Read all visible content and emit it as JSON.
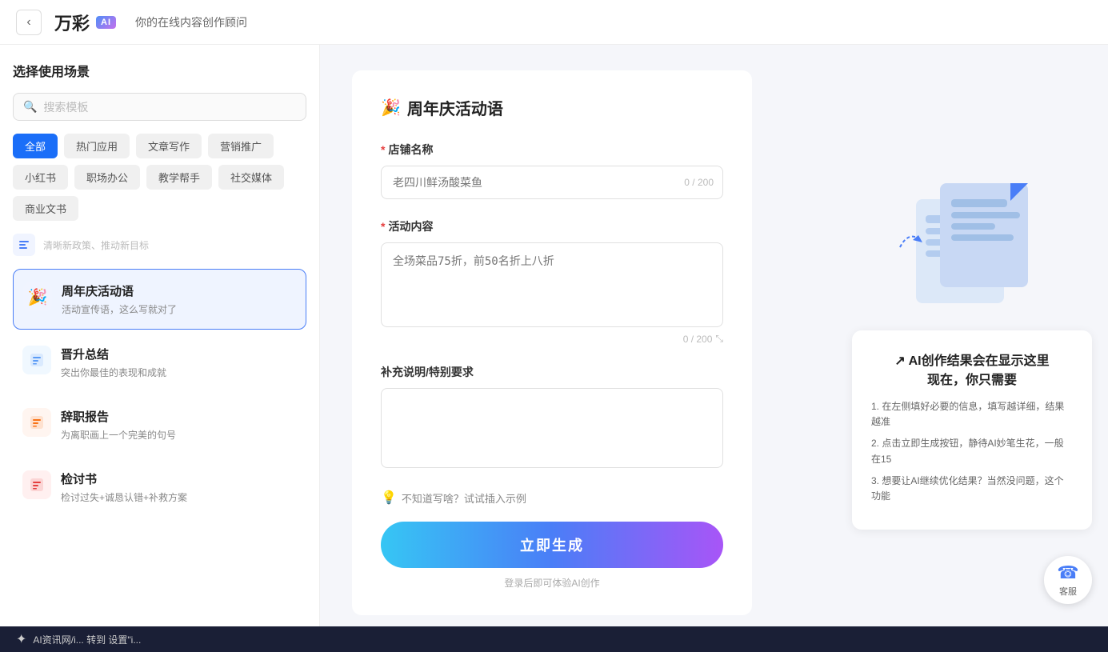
{
  "header": {
    "back_label": "‹",
    "logo_text": "万彩",
    "logo_ai": "AI",
    "subtitle": "你的在线内容创作顾问"
  },
  "sidebar": {
    "title": "选择使用场景",
    "search_placeholder": "搜索模板",
    "tags": [
      {
        "label": "全部",
        "active": true
      },
      {
        "label": "热门应用",
        "active": false
      },
      {
        "label": "文章写作",
        "active": false
      },
      {
        "label": "营销推广",
        "active": false
      },
      {
        "label": "小红书",
        "active": false
      },
      {
        "label": "职场办公",
        "active": false
      },
      {
        "label": "教学帮手",
        "active": false
      },
      {
        "label": "社交媒体",
        "active": false
      },
      {
        "label": "商业文书",
        "active": false
      }
    ],
    "divider_text": "清晰新政策、推动新目标",
    "items": [
      {
        "id": "anniversary",
        "icon": "🎉",
        "icon_bg": "#f0f4ff",
        "title": "周年庆活动语",
        "desc": "活动宣传语，这么写就对了",
        "active": true
      },
      {
        "id": "promotion",
        "icon": "📋",
        "icon_bg": "#f0f8ff",
        "title": "晋升总结",
        "desc": "突出你最佳的表现和成就",
        "active": false
      },
      {
        "id": "resignation",
        "icon": "📝",
        "icon_bg": "#fff5f0",
        "title": "辞职报告",
        "desc": "为离职画上一个完美的句号",
        "active": false
      },
      {
        "id": "review",
        "icon": "📌",
        "icon_bg": "#fff0f0",
        "title": "检讨书",
        "desc": "检讨过失+诚恳认错+补救方案",
        "active": false
      }
    ]
  },
  "form": {
    "title": "周年庆活动语",
    "title_icon": "🎉",
    "fields": {
      "shop_name": {
        "label": "店铺名称",
        "required": true,
        "placeholder": "老四川鲜汤酸菜鱼",
        "char_count": "0 / 200"
      },
      "activity_content": {
        "label": "活动内容",
        "required": true,
        "placeholder": "全场菜品75折，前50名折上八折",
        "char_count": "0 / 200"
      },
      "supplement": {
        "label": "补充说明/特别要求",
        "required": false,
        "placeholder": ""
      }
    },
    "hint_icon": "💡",
    "hint_text": "不知道写啥？试试插入示例",
    "generate_btn": "立即生成",
    "login_hint": "登录后即可体验AI创作"
  },
  "right_panel": {
    "info_title_prefix": "AI创作结果会在显示这里",
    "info_subtitle": "现在，你只需要",
    "info_items": [
      "1. 在左侧填好必要的信息，填写越详细，结果越准",
      "2. 点击立即生成按钮，静待AI妙笔生花，一般在15",
      "3. 想要让AI继续优化结果？当然没问题，这个功能"
    ]
  },
  "customer_service": {
    "icon": "☎",
    "label": "客服"
  },
  "bottom_bar": {
    "logo": "✦",
    "text": "AI资讯网/i... 转到 设置\"i..."
  }
}
